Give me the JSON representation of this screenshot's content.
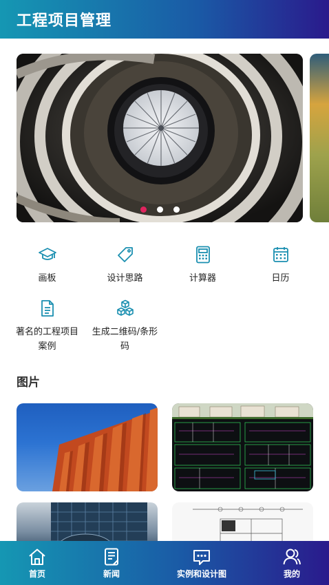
{
  "header": {
    "title": "工程项目管理"
  },
  "carousel": {
    "slide_count": 3,
    "active_index": 0,
    "accent": "#e0245e"
  },
  "quick_actions": [
    {
      "label": "画板",
      "icon": "graduation-cap-icon"
    },
    {
      "label": "设计思路",
      "icon": "tag-icon"
    },
    {
      "label": "计算器",
      "icon": "calculator-icon"
    },
    {
      "label": "日历",
      "icon": "calendar-icon"
    },
    {
      "label": "著名的工程项目案例",
      "icon": "document-icon"
    },
    {
      "label": "生成二维码/条形码",
      "icon": "cubes-icon"
    }
  ],
  "gallery": {
    "title": "图片"
  },
  "tabbar": {
    "items": [
      {
        "label": "首页",
        "icon": "home-icon"
      },
      {
        "label": "新闻",
        "icon": "news-icon"
      },
      {
        "label": "实例和设计图",
        "icon": "chat-icon"
      },
      {
        "label": "我的",
        "icon": "user-icon"
      }
    ]
  },
  "colors": {
    "primary": "#1597b3",
    "gradient_end": "#2a1a8c",
    "icon": "#1a8fb0"
  }
}
